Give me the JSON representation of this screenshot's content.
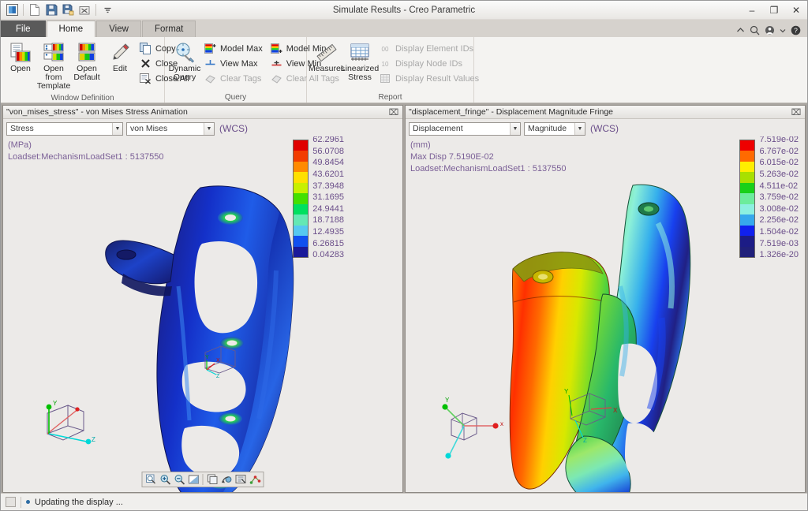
{
  "window": {
    "title": "Simulate Results - Creo Parametric",
    "minimize": "–",
    "maximize": "❐",
    "close": "✕"
  },
  "quick_access": [
    {
      "name": "app-logo-icon",
      "label": "Creo"
    },
    {
      "name": "new-icon",
      "label": "New"
    },
    {
      "name": "save-icon",
      "label": "Save"
    },
    {
      "name": "save-as-icon",
      "label": "Save As"
    },
    {
      "name": "close-window-icon",
      "label": "Close Window"
    },
    {
      "name": "customize-quick-access-icon",
      "label": "Customize Quick Access Toolbar"
    }
  ],
  "tabs": [
    {
      "label": "File",
      "active": false,
      "file": true
    },
    {
      "label": "Home",
      "active": true,
      "file": false
    },
    {
      "label": "View",
      "active": false,
      "file": false
    },
    {
      "label": "Format",
      "active": false,
      "file": false
    }
  ],
  "tab_right_icons": [
    {
      "name": "collapse-ribbon-icon",
      "glyph": "˄"
    },
    {
      "name": "search-icon",
      "glyph": "⚲"
    },
    {
      "name": "account-icon",
      "glyph": "☺"
    },
    {
      "name": "account-dropdown-icon",
      "glyph": "▾"
    },
    {
      "name": "help-icon",
      "glyph": "?"
    }
  ],
  "ribbon": {
    "groups": [
      {
        "title": "Window Definition",
        "big_buttons": [
          {
            "name": "open-button",
            "label": "Open",
            "icon": "open-window-icon"
          },
          {
            "name": "open-from-template-button",
            "label": "Open from\nTemplate",
            "icon": "open-template-icon"
          },
          {
            "name": "open-default-button",
            "label": "Open\nDefault",
            "icon": "open-default-icon"
          },
          {
            "name": "edit-button",
            "label": "Edit",
            "icon": "pencil-icon"
          }
        ],
        "small_buttons": [
          {
            "name": "copy-button",
            "label": "Copy",
            "icon": "copy-icon",
            "disabled": false
          },
          {
            "name": "close-button",
            "label": "Close",
            "icon": "close-x-icon",
            "disabled": false
          },
          {
            "name": "close-all-button",
            "label": "Close All",
            "icon": "close-all-icon",
            "disabled": false
          }
        ]
      },
      {
        "title": "Query",
        "big_buttons": [
          {
            "name": "dynamic-query-button",
            "label": "Dynamic\nQuery",
            "icon": "dynamic-query-icon"
          }
        ],
        "small_buttons": [
          {
            "name": "model-max-button",
            "label": "Model Max",
            "icon": "model-max-icon",
            "disabled": false
          },
          {
            "name": "view-max-button",
            "label": "View Max",
            "icon": "view-max-icon",
            "disabled": false
          },
          {
            "name": "clear-tags-button",
            "label": "Clear Tags",
            "icon": "clear-tags-icon",
            "disabled": true
          }
        ],
        "small_buttons2": [
          {
            "name": "model-min-button",
            "label": "Model Min",
            "icon": "model-min-icon",
            "disabled": false
          },
          {
            "name": "view-min-button",
            "label": "View Min",
            "icon": "view-min-icon",
            "disabled": false
          },
          {
            "name": "clear-all-tags-button",
            "label": "Clear All Tags",
            "icon": "clear-all-tags-icon",
            "disabled": true
          }
        ]
      },
      {
        "title": "Report",
        "big_buttons": [
          {
            "name": "measures-button",
            "label": "Measures",
            "icon": "ruler-icon"
          },
          {
            "name": "linearized-stress-button",
            "label": "Linearized\nStress",
            "icon": "linearized-stress-icon"
          }
        ],
        "small_buttons": [
          {
            "name": "display-element-ids-button",
            "label": "Display Element IDs",
            "icon": "element-ids-icon",
            "disabled": true
          },
          {
            "name": "display-node-ids-button",
            "label": "Display Node IDs",
            "icon": "node-ids-icon",
            "disabled": true
          },
          {
            "name": "display-result-values-button",
            "label": "Display Result Values",
            "icon": "result-values-icon",
            "disabled": true
          }
        ]
      }
    ]
  },
  "panels": [
    {
      "name": "von-mises-panel",
      "title": "\"von_mises_stress\" - von Mises Stress Animation",
      "close_glyph": "⌧",
      "quantity_select": {
        "name": "quantity-select",
        "value": "Stress"
      },
      "component_select": {
        "name": "component-select",
        "value": "von Mises"
      },
      "coordinate_system": "(WCS)",
      "units": "(MPa)",
      "loadset": "Loadset:MechanismLoadSet1 :  5137550",
      "max_disp": "",
      "legend": {
        "values": [
          "62.2961",
          "56.0708",
          "49.8454",
          "43.6201",
          "37.3948",
          "31.1695",
          "24.9441",
          "18.7188",
          "12.4935",
          "6.26815",
          "0.04283"
        ],
        "colors": [
          "#e00000",
          "#f23c00",
          "#ff8a00",
          "#ffe000",
          "#c8f000",
          "#44e000",
          "#00e060",
          "#64e8b4",
          "#56c8f0",
          "#1050f0",
          "#1a1a9a"
        ]
      }
    },
    {
      "name": "displacement-panel",
      "title": "\"displacement_fringe\" - Displacement Magnitude Fringe",
      "close_glyph": "⌧",
      "quantity_select": {
        "name": "quantity-select",
        "value": "Displacement"
      },
      "component_select": {
        "name": "component-select",
        "value": "Magnitude"
      },
      "coordinate_system": "(WCS)",
      "units": "(mm)",
      "loadset": "Loadset:MechanismLoadSet1 :  5137550",
      "max_disp": "Max Disp  7.5190E-02",
      "legend": {
        "values": [
          "7.519e-02",
          "6.767e-02",
          "6.015e-02",
          "5.263e-02",
          "4.511e-02",
          "3.759e-02",
          "3.008e-02",
          "2.256e-02",
          "1.504e-02",
          "7.519e-03",
          "1.326e-20"
        ],
        "colors": [
          "#ee0000",
          "#ff6a00",
          "#ffee00",
          "#a8e000",
          "#18d018",
          "#6cec9c",
          "#8cf0e0",
          "#36a8ec",
          "#1020ee",
          "#1c1c86",
          "#20207a"
        ]
      }
    }
  ],
  "view_toolbar": [
    {
      "name": "refit-icon",
      "label": "Refit"
    },
    {
      "name": "zoom-in-icon",
      "label": "Zoom In"
    },
    {
      "name": "zoom-out-icon",
      "label": "Zoom Out"
    },
    {
      "name": "repaint-icon",
      "label": "Repaint"
    },
    {
      "name": "saved-views-icon",
      "label": "Saved Views"
    },
    {
      "name": "spin-center-icon",
      "label": "Spin Center"
    },
    {
      "name": "display-style-icon",
      "label": "Display Style"
    },
    {
      "name": "datum-display-icon",
      "label": "Datum Display Filters"
    }
  ],
  "status_bar": {
    "message": "Updating the display ..."
  },
  "triad": {
    "axis_x": "x",
    "axis_y": "Y",
    "axis_z": "Z",
    "colors": {
      "x": "#e02020",
      "y": "#00c000",
      "z": "#00d8d8"
    }
  }
}
